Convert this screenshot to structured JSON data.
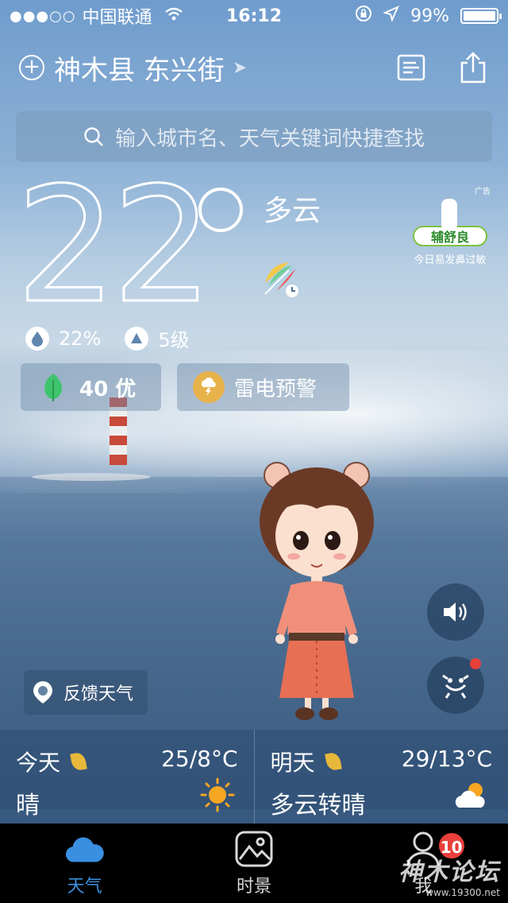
{
  "status_bar": {
    "signal": "●●●○○",
    "carrier": "中国联通",
    "time": "16:12",
    "battery": "99%",
    "battery_level": 0.99
  },
  "header": {
    "location": "神木县 东兴街"
  },
  "search": {
    "placeholder": "输入城市名、天气关键词快捷查找"
  },
  "current": {
    "temperature": "22",
    "condition": "多云",
    "humidity": "22%",
    "wind": "5级",
    "aqi": "40 优",
    "warning": "雷电预警"
  },
  "ad": {
    "label": "广告",
    "brand": "辅舒良",
    "slogan": "今日易发鼻过敏"
  },
  "feedback": {
    "label": "反馈天气"
  },
  "forecast": [
    {
      "day": "今天",
      "range": "25/8°C",
      "condition": "晴",
      "icon": "sun-icon"
    },
    {
      "day": "明天",
      "range": "29/13°C",
      "condition": "多云转晴",
      "icon": "partly-cloudy-icon"
    }
  ],
  "tabs": [
    {
      "label": "天气",
      "icon": "cloud-icon",
      "active": true
    },
    {
      "label": "时景",
      "icon": "picture-icon",
      "active": false
    },
    {
      "label": "我",
      "icon": "person-icon",
      "active": false,
      "badge": "10"
    }
  ],
  "watermark": {
    "title": "神木论坛",
    "url": "www.19300.net"
  },
  "colors": {
    "accent": "#3a8fe0",
    "warning": "#e8b24b",
    "badge": "#e8403a",
    "aqi_leaf": "#3ec46d"
  }
}
